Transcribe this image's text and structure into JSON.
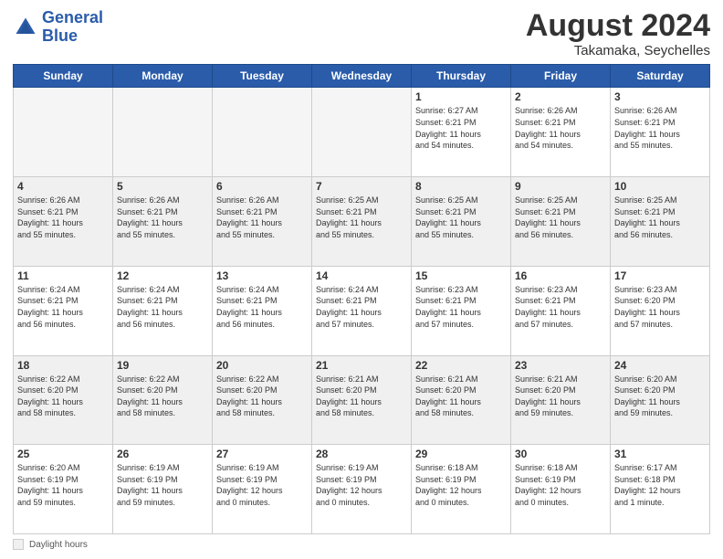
{
  "logo": {
    "line1": "General",
    "line2": "Blue"
  },
  "header": {
    "month": "August 2024",
    "location": "Takamaka, Seychelles"
  },
  "days_of_week": [
    "Sunday",
    "Monday",
    "Tuesday",
    "Wednesday",
    "Thursday",
    "Friday",
    "Saturday"
  ],
  "footer": {
    "legend_label": "Daylight hours"
  },
  "weeks": [
    [
      {
        "day": "",
        "info": ""
      },
      {
        "day": "",
        "info": ""
      },
      {
        "day": "",
        "info": ""
      },
      {
        "day": "",
        "info": ""
      },
      {
        "day": "1",
        "info": "Sunrise: 6:27 AM\nSunset: 6:21 PM\nDaylight: 11 hours\nand 54 minutes."
      },
      {
        "day": "2",
        "info": "Sunrise: 6:26 AM\nSunset: 6:21 PM\nDaylight: 11 hours\nand 54 minutes."
      },
      {
        "day": "3",
        "info": "Sunrise: 6:26 AM\nSunset: 6:21 PM\nDaylight: 11 hours\nand 55 minutes."
      }
    ],
    [
      {
        "day": "4",
        "info": "Sunrise: 6:26 AM\nSunset: 6:21 PM\nDaylight: 11 hours\nand 55 minutes."
      },
      {
        "day": "5",
        "info": "Sunrise: 6:26 AM\nSunset: 6:21 PM\nDaylight: 11 hours\nand 55 minutes."
      },
      {
        "day": "6",
        "info": "Sunrise: 6:26 AM\nSunset: 6:21 PM\nDaylight: 11 hours\nand 55 minutes."
      },
      {
        "day": "7",
        "info": "Sunrise: 6:25 AM\nSunset: 6:21 PM\nDaylight: 11 hours\nand 55 minutes."
      },
      {
        "day": "8",
        "info": "Sunrise: 6:25 AM\nSunset: 6:21 PM\nDaylight: 11 hours\nand 55 minutes."
      },
      {
        "day": "9",
        "info": "Sunrise: 6:25 AM\nSunset: 6:21 PM\nDaylight: 11 hours\nand 56 minutes."
      },
      {
        "day": "10",
        "info": "Sunrise: 6:25 AM\nSunset: 6:21 PM\nDaylight: 11 hours\nand 56 minutes."
      }
    ],
    [
      {
        "day": "11",
        "info": "Sunrise: 6:24 AM\nSunset: 6:21 PM\nDaylight: 11 hours\nand 56 minutes."
      },
      {
        "day": "12",
        "info": "Sunrise: 6:24 AM\nSunset: 6:21 PM\nDaylight: 11 hours\nand 56 minutes."
      },
      {
        "day": "13",
        "info": "Sunrise: 6:24 AM\nSunset: 6:21 PM\nDaylight: 11 hours\nand 56 minutes."
      },
      {
        "day": "14",
        "info": "Sunrise: 6:24 AM\nSunset: 6:21 PM\nDaylight: 11 hours\nand 57 minutes."
      },
      {
        "day": "15",
        "info": "Sunrise: 6:23 AM\nSunset: 6:21 PM\nDaylight: 11 hours\nand 57 minutes."
      },
      {
        "day": "16",
        "info": "Sunrise: 6:23 AM\nSunset: 6:21 PM\nDaylight: 11 hours\nand 57 minutes."
      },
      {
        "day": "17",
        "info": "Sunrise: 6:23 AM\nSunset: 6:20 PM\nDaylight: 11 hours\nand 57 minutes."
      }
    ],
    [
      {
        "day": "18",
        "info": "Sunrise: 6:22 AM\nSunset: 6:20 PM\nDaylight: 11 hours\nand 58 minutes."
      },
      {
        "day": "19",
        "info": "Sunrise: 6:22 AM\nSunset: 6:20 PM\nDaylight: 11 hours\nand 58 minutes."
      },
      {
        "day": "20",
        "info": "Sunrise: 6:22 AM\nSunset: 6:20 PM\nDaylight: 11 hours\nand 58 minutes."
      },
      {
        "day": "21",
        "info": "Sunrise: 6:21 AM\nSunset: 6:20 PM\nDaylight: 11 hours\nand 58 minutes."
      },
      {
        "day": "22",
        "info": "Sunrise: 6:21 AM\nSunset: 6:20 PM\nDaylight: 11 hours\nand 58 minutes."
      },
      {
        "day": "23",
        "info": "Sunrise: 6:21 AM\nSunset: 6:20 PM\nDaylight: 11 hours\nand 59 minutes."
      },
      {
        "day": "24",
        "info": "Sunrise: 6:20 AM\nSunset: 6:20 PM\nDaylight: 11 hours\nand 59 minutes."
      }
    ],
    [
      {
        "day": "25",
        "info": "Sunrise: 6:20 AM\nSunset: 6:19 PM\nDaylight: 11 hours\nand 59 minutes."
      },
      {
        "day": "26",
        "info": "Sunrise: 6:19 AM\nSunset: 6:19 PM\nDaylight: 11 hours\nand 59 minutes."
      },
      {
        "day": "27",
        "info": "Sunrise: 6:19 AM\nSunset: 6:19 PM\nDaylight: 12 hours\nand 0 minutes."
      },
      {
        "day": "28",
        "info": "Sunrise: 6:19 AM\nSunset: 6:19 PM\nDaylight: 12 hours\nand 0 minutes."
      },
      {
        "day": "29",
        "info": "Sunrise: 6:18 AM\nSunset: 6:19 PM\nDaylight: 12 hours\nand 0 minutes."
      },
      {
        "day": "30",
        "info": "Sunrise: 6:18 AM\nSunset: 6:19 PM\nDaylight: 12 hours\nand 0 minutes."
      },
      {
        "day": "31",
        "info": "Sunrise: 6:17 AM\nSunset: 6:18 PM\nDaylight: 12 hours\nand 1 minute."
      }
    ]
  ]
}
